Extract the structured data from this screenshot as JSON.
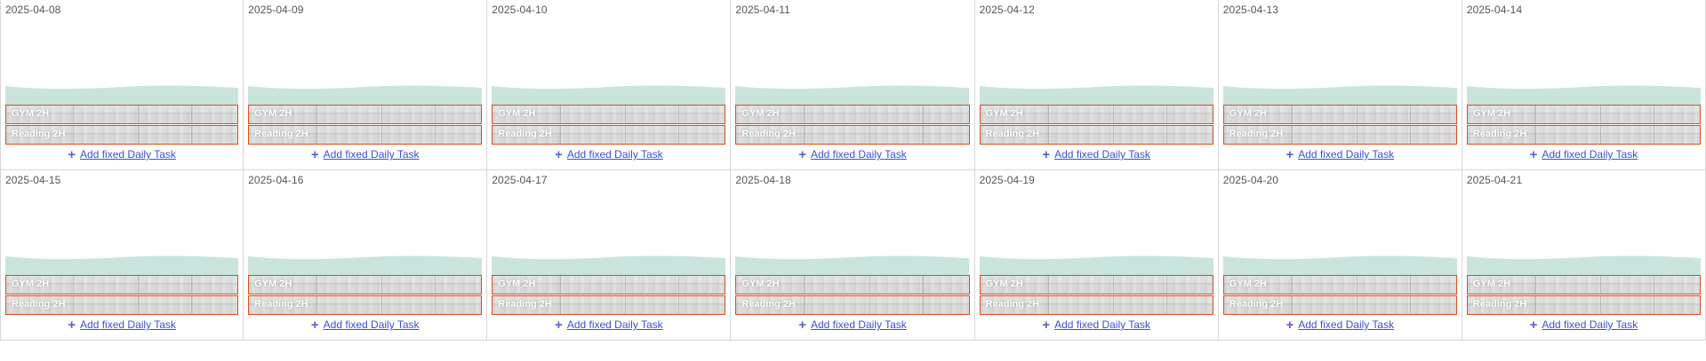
{
  "calendar": {
    "days": [
      {
        "date": "2025-04-08"
      },
      {
        "date": "2025-04-09"
      },
      {
        "date": "2025-04-10"
      },
      {
        "date": "2025-04-11"
      },
      {
        "date": "2025-04-12"
      },
      {
        "date": "2025-04-13"
      },
      {
        "date": "2025-04-14"
      },
      {
        "date": "2025-04-15"
      },
      {
        "date": "2025-04-16"
      },
      {
        "date": "2025-04-17"
      },
      {
        "date": "2025-04-18"
      },
      {
        "date": "2025-04-19"
      },
      {
        "date": "2025-04-20"
      },
      {
        "date": "2025-04-21"
      }
    ],
    "tasks": [
      {
        "label": "GYM 2H"
      },
      {
        "label": "Reading 2H"
      }
    ],
    "add_link": {
      "icon": "plus-icon",
      "label": "Add fixed Daily Task"
    }
  },
  "colors": {
    "wave": "#c9e4dd",
    "task_border": "#d9501e",
    "link": "#3b4fd8",
    "cell_border": "#d6d6d6"
  }
}
